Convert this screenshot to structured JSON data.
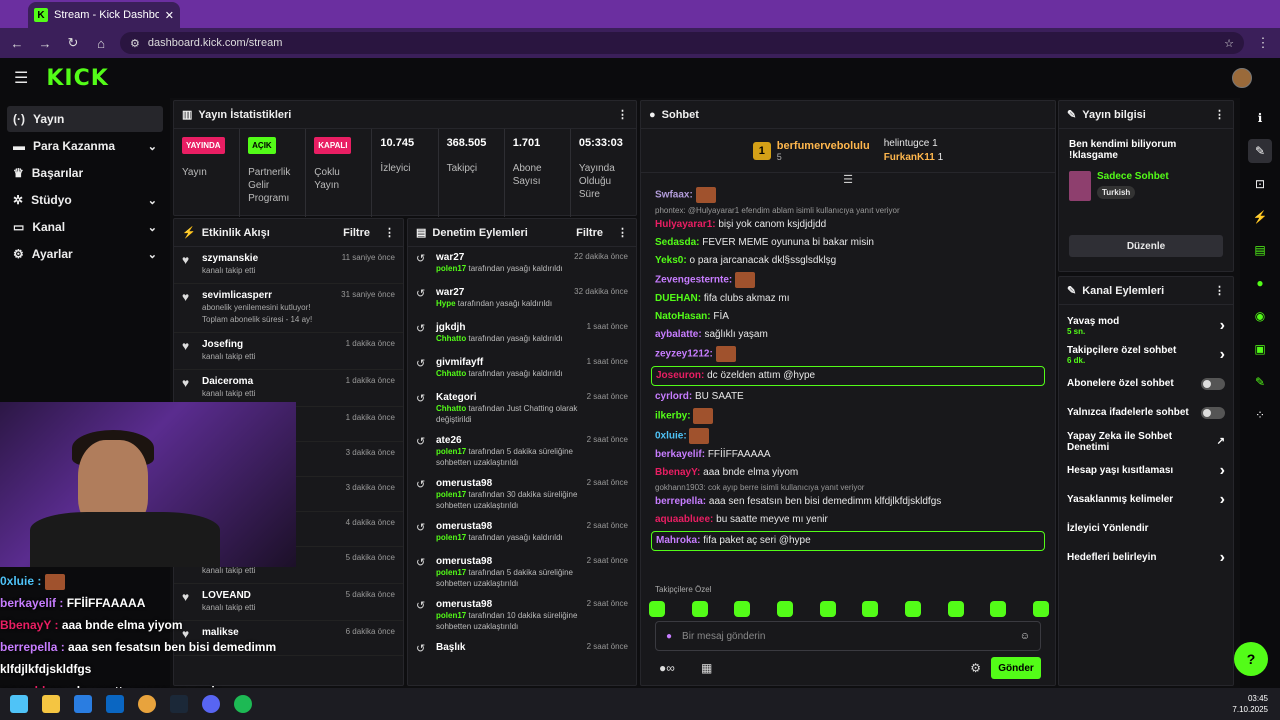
{
  "browser": {
    "tab_title": "Stream - Kick Dashboard",
    "url": "dashboard.kick.com/stream"
  },
  "header": {
    "logo": "KICK"
  },
  "sidebar": {
    "items": [
      {
        "label": "Yayın",
        "icon": "broadcast-icon"
      },
      {
        "label": "Para Kazanma",
        "icon": "money-icon"
      },
      {
        "label": "Başarılar",
        "icon": "trophy-icon"
      },
      {
        "label": "Stüdyo",
        "icon": "studio-icon"
      },
      {
        "label": "Kanal",
        "icon": "channel-icon"
      },
      {
        "label": "Ayarlar",
        "icon": "gear-icon"
      }
    ]
  },
  "stats": {
    "title": "Yayın İstatistikleri",
    "cols": [
      {
        "badge": "YAYINDA",
        "label": "Yayın",
        "color": "#e91e63"
      },
      {
        "badge": "AÇIK",
        "label": "Partnerlik Gelir Programı",
        "color": "#53fc18"
      },
      {
        "badge": "KAPALI",
        "label": "Çoklu Yayın",
        "color": "#e91e63"
      },
      {
        "value": "10.745",
        "label": "İzleyici"
      },
      {
        "value": "368.505",
        "label": "Takipçi"
      },
      {
        "value": "1.701",
        "label": "Abone Sayısı"
      },
      {
        "value": "05:33:03",
        "label": "Yayında Olduğu Süre"
      }
    ]
  },
  "activity": {
    "title": "Etkinlik Akışı",
    "filter": "Filtre",
    "items": [
      {
        "name": "szymanskie",
        "sub": "kanalı takip etti",
        "time": "11 saniye önce"
      },
      {
        "name": "sevimlicasperr",
        "sub": "abonelik yenilemesini kutluyor! Toplam abonelik süresi - 14 ay!",
        "time": "31 saniye önce"
      },
      {
        "name": "Josefing",
        "sub": "kanalı takip etti",
        "time": "1 dakika önce"
      },
      {
        "name": "Daiceroma",
        "sub": "kanalı takip etti",
        "time": "1 dakika önce"
      },
      {
        "name": "",
        "sub": "",
        "time": "1 dakika önce"
      },
      {
        "name": "",
        "sub": "",
        "time": "3 dakika önce"
      },
      {
        "name": "",
        "sub": "",
        "time": "3 dakika önce"
      },
      {
        "name": "",
        "sub": "",
        "time": "4 dakika önce"
      },
      {
        "name": "Matker",
        "sub": "kanalı takip etti",
        "time": "5 dakika önce"
      },
      {
        "name": "LOVEAND",
        "sub": "kanalı takip etti",
        "time": "5 dakika önce"
      },
      {
        "name": "malikse",
        "sub": "",
        "time": "6 dakika önce"
      }
    ]
  },
  "moderation": {
    "title": "Denetim Eylemleri",
    "filter": "Filtre",
    "items": [
      {
        "name": "war27",
        "who": "polen17",
        "sub": "tarafından yasağı kaldırıldı",
        "time": "22 dakika önce"
      },
      {
        "name": "war27",
        "who": "Hype",
        "sub": "tarafından yasağı kaldırıldı",
        "time": "32 dakika önce"
      },
      {
        "name": "jgkdjh",
        "who": "Chhatto",
        "sub": "tarafından yasağı kaldırıldı",
        "time": "1 saat önce"
      },
      {
        "name": "givmifayff",
        "who": "Chhatto",
        "sub": "tarafından yasağı kaldırıldı",
        "time": "1 saat önce"
      },
      {
        "name": "Kategori",
        "who": "Chhatto",
        "sub": "tarafından Just Chatting olarak değiştirildi",
        "time": "2 saat önce"
      },
      {
        "name": "ate26",
        "who": "polen17",
        "sub": "tarafından 5 dakika süreliğine sohbetten uzaklaştırıldı",
        "time": "2 saat önce"
      },
      {
        "name": "omerusta98",
        "who": "polen17",
        "sub": "tarafından 30 dakika süreliğine sohbetten uzaklaştırıldı",
        "time": "2 saat önce"
      },
      {
        "name": "omerusta98",
        "who": "polen17",
        "sub": "tarafından yasağı kaldırıldı",
        "time": "2 saat önce"
      },
      {
        "name": "omerusta98",
        "who": "polen17",
        "sub": "tarafından 5 dakika süreliğine sohbetten uzaklaştırıldı",
        "time": "2 saat önce"
      },
      {
        "name": "omerusta98",
        "who": "polen17",
        "sub": "tarafından 10 dakika süreliğine sohbetten uzaklaştırıldı",
        "time": "2 saat önce"
      },
      {
        "name": "Başlık",
        "who": "",
        "sub": "",
        "time": "2 saat önce"
      }
    ]
  },
  "chat": {
    "title": "Sohbet",
    "leader1": "berfumervebolulu",
    "leader1_count": "5",
    "leader2": "helintugce",
    "leader2_count": "1",
    "leader3": "FurkanK11",
    "leader3_count": "1",
    "messages": [
      {
        "user": "Swfaax:",
        "text": "",
        "color": "#b39ddb"
      },
      {
        "reply": "phontex: @Hulyayarar1 efendim ablam isimli kullanıcıya yanıt veriyor"
      },
      {
        "user": "Hulyayarar1:",
        "text": "bişi yok canom ksjdjdjdd",
        "color": "#e91e63"
      },
      {
        "user": "Sedasda:",
        "text": "FEVER MEME oyununa bi bakar misin",
        "color": "#53fc18"
      },
      {
        "user": "Yeks0:",
        "text": "o para jarcanacak dkl§ssglsdklşg",
        "color": "#53fc18"
      },
      {
        "user": "Zevengesternte:",
        "text": "",
        "color": "#c77dff"
      },
      {
        "user": "DUEHAN:",
        "text": "fifa clubs akmaz mı",
        "color": "#53fc18"
      },
      {
        "user": "NatoHasan:",
        "text": "FİA",
        "color": "#53fc18"
      },
      {
        "user": "aybalatte:",
        "text": "sağlıklı yaşam",
        "color": "#c77dff"
      },
      {
        "user": "zeyzey1212:",
        "text": "",
        "color": "#c77dff"
      },
      {
        "user": "Joseuron:",
        "text": "dc özelden attım @hype",
        "color": "#e91e63",
        "hl": true
      },
      {
        "user": "cyrlord:",
        "text": "BU SAATE",
        "color": "#c77dff"
      },
      {
        "user": "ilkerby:",
        "text": "",
        "color": "#53fc18"
      },
      {
        "user": "0xluie:",
        "text": "",
        "color": "#4fc3f7"
      },
      {
        "user": "berkayelif:",
        "text": "FFİİFFAAAAA",
        "color": "#c77dff"
      },
      {
        "user": "BbenayY:",
        "text": "aaa bnde elma yiyom",
        "color": "#e91e63"
      },
      {
        "reply": "gokhann1903: cok ayıp berre isimli kullanıcıya yanıt veriyor"
      },
      {
        "user": "berrepella:",
        "text": "aaa sen fesatsın ben bisi demedimm klfdjlkfdjskldfgs",
        "color": "#c77dff"
      },
      {
        "user": "aquaabluee:",
        "text": "bu saatte meyve mı yenir",
        "color": "#e91e63"
      },
      {
        "user": "Mahroka:",
        "text": "fifa paket aç seri @hype",
        "color": "#c77dff",
        "hl": true
      }
    ],
    "followers_only": "Takipçilere Özel",
    "input_placeholder": "Bir mesaj gönderin",
    "send": "Gönder"
  },
  "info": {
    "title": "Yayın bilgisi",
    "stream_title": "Ben kendimi biliyorum !klasgame",
    "category": "Sadece Sohbet",
    "tag": "Turkish",
    "edit": "Düzenle"
  },
  "actions": {
    "title": "Kanal Eylemleri",
    "items": [
      {
        "label": "Yavaş mod",
        "sub": "5 sn.",
        "ctl": "chevron"
      },
      {
        "label": "Takipçilere özel sohbet",
        "sub": "6 dk.",
        "ctl": "chevron"
      },
      {
        "label": "Abonelere özel sohbet",
        "sub": "",
        "ctl": "toggle"
      },
      {
        "label": "Yalnızca ifadelerle sohbet",
        "sub": "",
        "ctl": "toggle"
      },
      {
        "label": "Yapay Zeka ile Sohbet Denetimi",
        "sub": "",
        "ctl": "external"
      },
      {
        "label": "Hesap yaşı kısıtlaması",
        "sub": "",
        "ctl": "chevron"
      },
      {
        "label": "Yasaklanmış kelimeler",
        "sub": "",
        "ctl": "chevron"
      },
      {
        "label": "İzleyici Yönlendir",
        "sub": "",
        "ctl": "none"
      },
      {
        "label": "Hedefleri belirleyin",
        "sub": "",
        "ctl": "chevron"
      }
    ]
  },
  "overlay": {
    "lines": [
      {
        "user": "0xluie :",
        "text": "",
        "color": "#4fc3f7"
      },
      {
        "user": "berkayelif :",
        "text": "FFİİFFAAAAA",
        "color": "#c77dff"
      },
      {
        "user": "BbenayY :",
        "text": "aaa bnde elma yiyom",
        "color": "#e91e63"
      },
      {
        "user": "berrepella :",
        "text": "aaa sen fesatsın ben bisi demedimm klfdjlkfdjskldfgs",
        "color": "#c77dff"
      },
      {
        "user": "aquaabluee :",
        "text": "bu saatte meyve mı yenir",
        "color": "#e91e63"
      }
    ]
  },
  "taskbar": {
    "time": "03:45",
    "date": "7.10.2025"
  }
}
